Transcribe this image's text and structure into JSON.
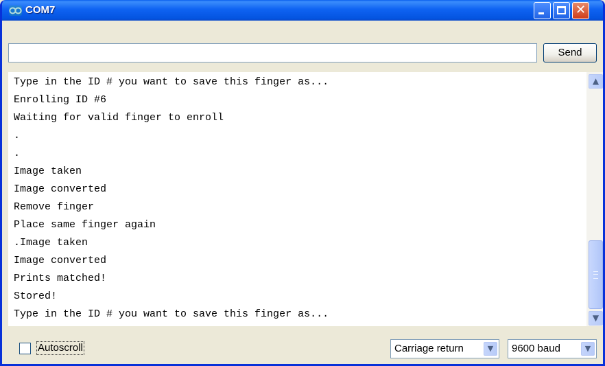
{
  "window": {
    "title": "COM7",
    "app_icon": "infinity-icon"
  },
  "titlebar_buttons": {
    "minimize": "minimize-icon",
    "maximize": "maximize-icon",
    "close": "close-icon",
    "close_glyph": "✕"
  },
  "send_bar": {
    "input_value": "",
    "send_label": "Send"
  },
  "output": {
    "lines": [
      "Type in the ID # you want to save this finger as...",
      "Enrolling ID #6",
      "Waiting for valid finger to enroll",
      ".",
      ".",
      "Image taken",
      "Image converted",
      "Remove finger",
      "Place same finger again",
      ".Image taken",
      "Image converted",
      "Prints matched!",
      "Stored!",
      "Type in the ID # you want to save this finger as..."
    ]
  },
  "scrollbar": {
    "up_glyph": "▲",
    "down_glyph": "▼",
    "position_fraction": 1.0
  },
  "footer": {
    "autoscroll_label": "Autoscroll",
    "autoscroll_checked": false,
    "line_ending": "Carriage return",
    "baud": "9600 baud",
    "dropdown_glyph": "▼"
  },
  "colors": {
    "titlebar": "#0a5fee",
    "close_button": "#cf3c19",
    "frame": "#ece9d8"
  }
}
